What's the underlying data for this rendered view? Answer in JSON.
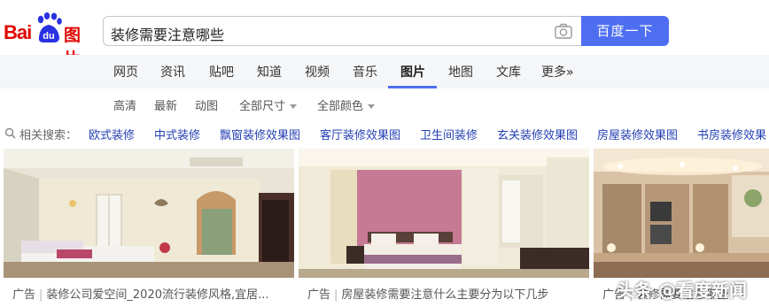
{
  "header": {
    "logo_text_latin": "Bai",
    "logo_text_du": "du",
    "logo_text_cn": "图片",
    "search_query": "装修需要注意哪些",
    "search_button": "百度一下",
    "brand_color": "#e10601",
    "accent_color": "#4e6ef2"
  },
  "nav": {
    "items": [
      {
        "label": "网页"
      },
      {
        "label": "资讯"
      },
      {
        "label": "贴吧"
      },
      {
        "label": "知道"
      },
      {
        "label": "视频"
      },
      {
        "label": "音乐"
      },
      {
        "label": "图片",
        "active": true
      },
      {
        "label": "地图"
      },
      {
        "label": "文库"
      },
      {
        "label": "更多»"
      }
    ]
  },
  "filters": {
    "items": [
      "高清",
      "最新",
      "动图",
      "全部尺寸",
      "全部颜色"
    ]
  },
  "related": {
    "label": "相关搜索：",
    "links": [
      "欧式装修",
      "中式装修",
      "飘窗装修效果图",
      "客厅装修效果图",
      "卫生间装修",
      "玄关装修效果图",
      "房屋装修效果图",
      "书房装修效果"
    ]
  },
  "results": [
    {
      "ad": "广告",
      "title": "装修公司爱空间_2020流行装修风格,宜居..."
    },
    {
      "ad": "广告",
      "title": "房屋装修需要注意什么主要分为以下几步"
    },
    {
      "ad": "广告",
      "title": "装修需要注意哪些"
    }
  ],
  "watermark": "头条 @看度新闻"
}
